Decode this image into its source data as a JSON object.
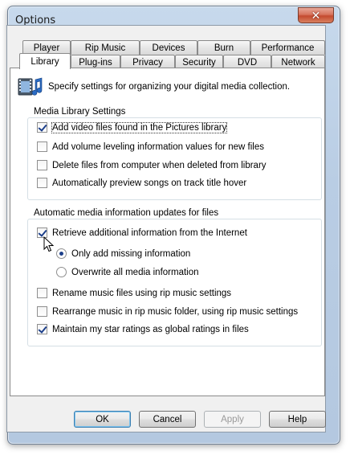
{
  "window": {
    "title": "Options",
    "close_symbol": "✕"
  },
  "tabs": {
    "back_row": [
      "Player",
      "Rip Music",
      "Devices",
      "Burn",
      "Performance"
    ],
    "front_row": [
      "Library",
      "Plug-ins",
      "Privacy",
      "Security",
      "DVD",
      "Network"
    ],
    "selected": "Library"
  },
  "header": {
    "description": "Specify settings for organizing your digital media collection."
  },
  "media_library_settings": {
    "label": "Media Library Settings",
    "items": [
      {
        "label": "Add video files found in the Pictures library",
        "checked": true
      },
      {
        "label": "Add volume leveling information values for new files",
        "checked": false
      },
      {
        "label": "Delete files from computer when deleted from library",
        "checked": false
      },
      {
        "label": "Automatically preview songs on track title hover",
        "checked": false
      }
    ]
  },
  "auto_updates": {
    "label": "Automatic media information updates for files",
    "retrieve": {
      "label": "Retrieve additional information from the Internet",
      "checked": true
    },
    "radios": [
      {
        "label": "Only add missing information",
        "selected": true
      },
      {
        "label": "Overwrite all media information",
        "selected": false
      }
    ],
    "items": [
      {
        "label": "Rename music files using rip music settings",
        "checked": false
      },
      {
        "label": "Rearrange music in rip music folder, using rip music settings",
        "checked": false
      },
      {
        "label": "Maintain my star ratings as global ratings in files",
        "checked": true
      }
    ]
  },
  "buttons": {
    "ok": "OK",
    "cancel": "Cancel",
    "apply": "Apply",
    "help": "Help"
  }
}
